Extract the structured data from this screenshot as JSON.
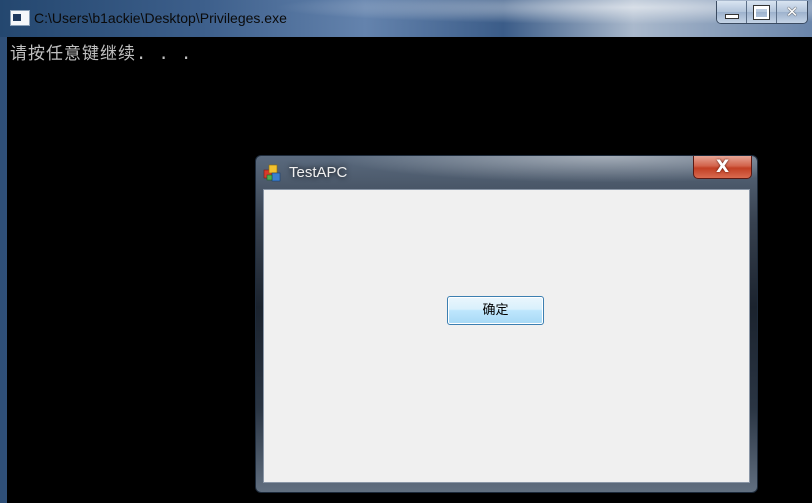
{
  "console": {
    "title": "C:\\Users\\b1ackie\\Desktop\\Privileges.exe",
    "output_line": "请按任意键继续. . ."
  },
  "window_buttons": {
    "minimize": "minimize-icon",
    "maximize": "maximize-icon",
    "close_glyph": "✕"
  },
  "dialog": {
    "title": "TestAPC",
    "close_glyph": "X",
    "ok_label": "确定"
  },
  "colors": {
    "console_bg": "#000000",
    "console_text": "#c0c0c0",
    "dialog_client": "#f0f0f0",
    "close_button_red": "#c23f24",
    "ok_button_border": "#3c7fb1"
  }
}
